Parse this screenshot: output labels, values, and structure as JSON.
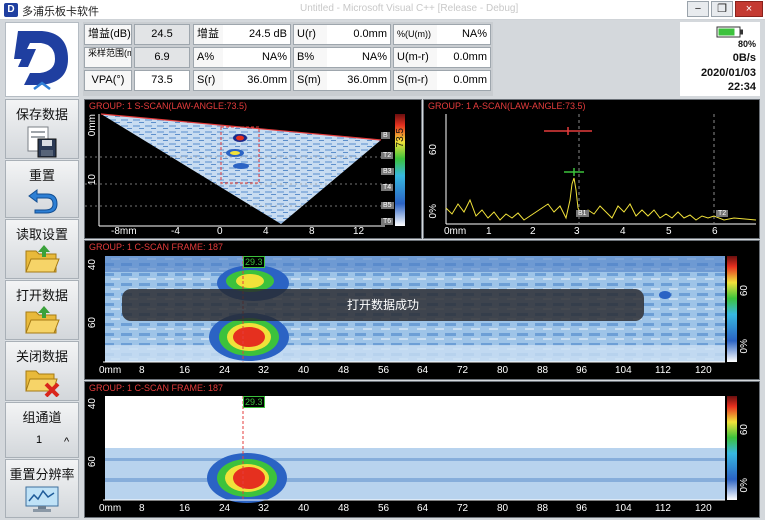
{
  "window": {
    "title": "多浦乐板卡软件",
    "ghost_title": "Untitled - Microsoft Visual C++ [Release - Debug]",
    "minimize": "−",
    "restore": "❐",
    "close": "×"
  },
  "logo": {
    "letter": "D",
    "accent": "#1f3fa0"
  },
  "sidebar": {
    "items": [
      {
        "label": "保存数据",
        "icon": "save-disk-icon"
      },
      {
        "label": "重置",
        "icon": "undo-arrow-icon"
      },
      {
        "label": "读取设置",
        "icon": "folder-open-icon"
      },
      {
        "label": "打开数据",
        "icon": "folder-open-icon"
      },
      {
        "label": "关闭数据",
        "icon": "folder-close-icon"
      },
      {
        "label": "组通道",
        "icon": "channel-spinner-icon"
      },
      {
        "label": "重置分辨率",
        "icon": "monitor-icon"
      }
    ],
    "channel_value": "1",
    "spinner_up": "^"
  },
  "readout": {
    "gain_label": "增益(dB)",
    "gain_value": "24.5",
    "range_label": "采样范围(mm)",
    "range_value": "6.9",
    "vpa_label": "VPA(°)",
    "vpa_value": "73.5",
    "r1": [
      {
        "label": "增益",
        "value": "24.5",
        "unit": "dB"
      },
      {
        "label": "U(r)",
        "value": "0.0",
        "unit": "mm"
      },
      {
        "label": "%(U(m))",
        "value": "NA%",
        "unit": ""
      }
    ],
    "r2": [
      {
        "label": "A%",
        "value": "NA%",
        "unit": ""
      },
      {
        "label": "B%",
        "value": "NA%",
        "unit": ""
      },
      {
        "label": "U(m-r)",
        "value": "0.0",
        "unit": "mm"
      }
    ],
    "r3": [
      {
        "label": "S(r)",
        "value": "36.0",
        "unit": "mm"
      },
      {
        "label": "S(m)",
        "value": "36.0",
        "unit": "mm"
      },
      {
        "label": "S(m-r)",
        "value": "0.0",
        "unit": "mm"
      }
    ]
  },
  "status": {
    "battery": "80%",
    "battery_level": 0.8,
    "speed": "0B/s",
    "date": "2020/01/03",
    "time": "22:34"
  },
  "sscan": {
    "title": "GROUP: 1 S-SCAN(LAW-ANGLE:73.5)",
    "yticks": [
      "0mm",
      "10"
    ],
    "xticks": [
      "-8mm",
      "-4",
      "0",
      "4",
      "8",
      "12"
    ],
    "angle": "73.5",
    "gate_tags": [
      "B",
      "T2",
      "B3",
      "T4",
      "B5",
      "T6"
    ]
  },
  "ascan": {
    "title": "GROUP: 1 A-SCAN(LAW-ANGLE:73.5)",
    "yticks": [
      "60",
      "0%"
    ],
    "xticks": [
      "0mm",
      "1",
      "2",
      "3",
      "4",
      "5",
      "6"
    ],
    "marker_b": "B1",
    "marker_t": "T2"
  },
  "cscan1": {
    "title": "GROUP: 1 C-SCAN FRAME: 187",
    "yticks": [
      "40",
      "60"
    ],
    "xticks": [
      "0mm",
      "8",
      "16",
      "24",
      "32",
      "40",
      "48",
      "56",
      "64",
      "72",
      "80",
      "88",
      "96",
      "104",
      "112",
      "120"
    ],
    "cursor": "29.3",
    "cbar_ticks": [
      "60",
      "0%"
    ]
  },
  "cscan2": {
    "title": "GROUP: 1 C-SCAN FRAME: 187",
    "yticks": [
      "40",
      "60"
    ],
    "xticks": [
      "0mm",
      "8",
      "16",
      "24",
      "32",
      "40",
      "48",
      "56",
      "64",
      "72",
      "80",
      "88",
      "96",
      "104",
      "112",
      "120"
    ],
    "cursor": "29.3",
    "cbar_ticks": [
      "60",
      "0%"
    ]
  },
  "toast": "打开数据成功"
}
